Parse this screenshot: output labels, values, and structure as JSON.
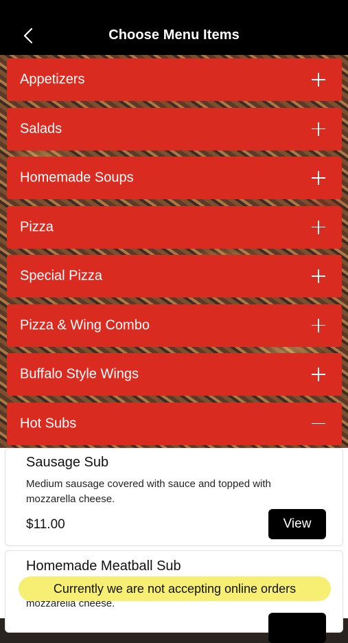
{
  "header": {
    "title": "Choose Menu Items",
    "back_icon": "chevron-left-icon"
  },
  "categories": [
    {
      "label": "Appetizers",
      "expanded": false
    },
    {
      "label": "Salads",
      "expanded": false
    },
    {
      "label": "Homemade Soups",
      "expanded": false
    },
    {
      "label": "Pizza",
      "expanded": false
    },
    {
      "label": "Special Pizza",
      "expanded": false
    },
    {
      "label": "Pizza & Wing Combo",
      "expanded": false
    },
    {
      "label": "Buffalo Style Wings",
      "expanded": false
    },
    {
      "label": "Hot Subs",
      "expanded": true
    }
  ],
  "items": [
    {
      "name": "Sausage Sub",
      "description": "Medium sausage covered with sauce and topped with mozzarella cheese.",
      "price": "$11.00",
      "view_label": "View"
    },
    {
      "name": "Homemade Meatball Sub",
      "description": "mozzarella cheese.",
      "view_label": ""
    }
  ],
  "notice": "Currently we are not accepting online orders",
  "colors": {
    "accent_red": "#d92b1f",
    "notice_yellow": "#f7ef73",
    "header_black": "#000000"
  }
}
